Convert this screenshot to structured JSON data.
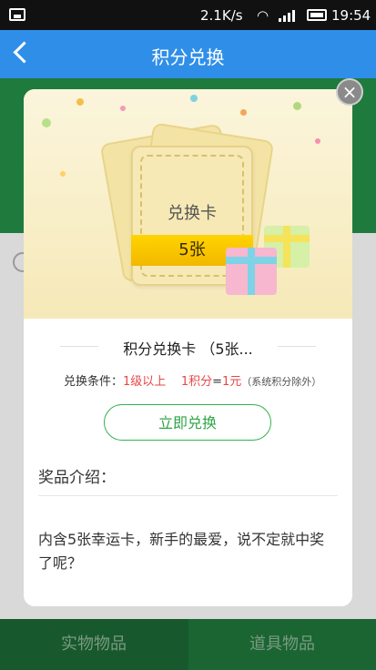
{
  "status": {
    "speed": "2.1K/s",
    "time": "19:54"
  },
  "nav": {
    "title": "积分兑换",
    "back_icon": "back-arrow-icon"
  },
  "bottom_tabs": {
    "left": "实物物品",
    "right": "道具物品"
  },
  "modal": {
    "banner": {
      "card_label": "兑换卡",
      "ribbon_text": "5张"
    },
    "title": "积分兑换卡 （5张...",
    "condition_label": "兑换条件：",
    "condition_value": "1级以上",
    "rate_left": "1积分",
    "rate_eq": "=",
    "rate_right": "1元",
    "rate_note": "（系统积分除外）",
    "exchange_button": "立即兑换",
    "intro_title": "奖品介绍：",
    "intro_body": "内含5张幸运卡，新手的最爱，说不定就中奖了呢？"
  },
  "colors": {
    "nav": "#2f8fe8",
    "accent_green": "#33b24b",
    "red": "#e84747"
  }
}
